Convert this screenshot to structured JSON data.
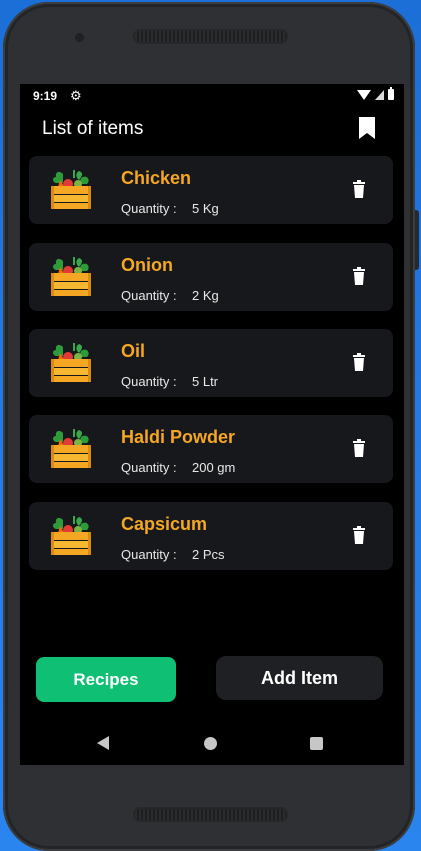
{
  "status_bar": {
    "time": "9:19",
    "icons": [
      "gear-icon",
      "wifi-icon",
      "signal-icon",
      "battery-icon"
    ]
  },
  "header": {
    "title": "List of items",
    "action_icon": "bookmark-icon"
  },
  "items": [
    {
      "name": "Chicken",
      "quantity_label": "Quantity :",
      "quantity": "5 Kg"
    },
    {
      "name": "Onion",
      "quantity_label": "Quantity :",
      "quantity": "2 Kg"
    },
    {
      "name": "Oil",
      "quantity_label": "Quantity :",
      "quantity": "5 Ltr"
    },
    {
      "name": "Haldi Powder",
      "quantity_label": "Quantity :",
      "quantity": "200 gm"
    },
    {
      "name": "Capsicum",
      "quantity_label": "Quantity :",
      "quantity": "2 Pcs"
    }
  ],
  "buttons": {
    "recipes": "Recipes",
    "add_item": "Add Item"
  },
  "colors": {
    "accent_item": "#f5a623",
    "recipes_button": "#0fbf73",
    "card": "#16181b",
    "screen": "#000000"
  }
}
